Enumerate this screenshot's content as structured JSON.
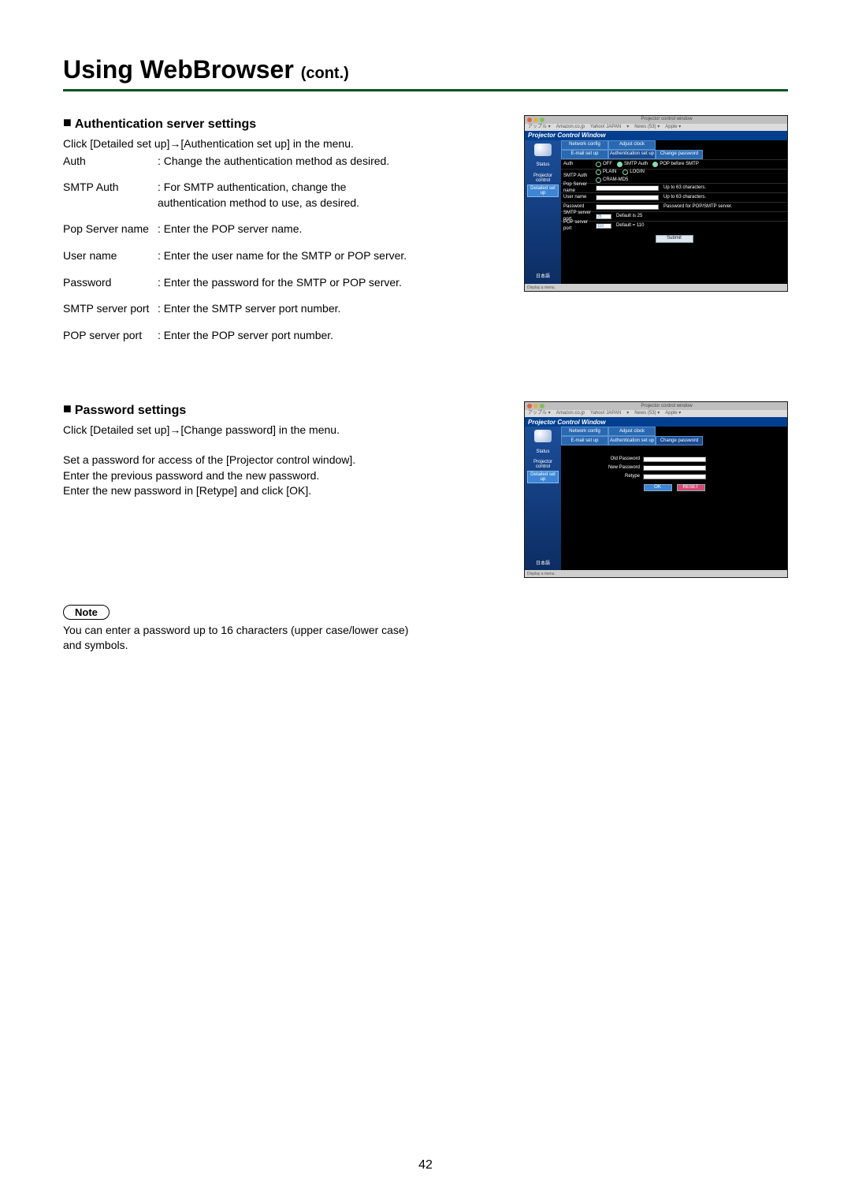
{
  "page_title_main": "Using WebBrowser ",
  "page_title_cont": "(cont.)",
  "page_number": "42",
  "section_auth": {
    "heading": "Authentication server settings",
    "intro": "Click [Detailed set up]→[Authentication set up] in the menu.",
    "items": [
      {
        "label": "Auth",
        "value": "Change the authentication method as desired."
      },
      {
        "label": "SMTP Auth",
        "value": "For SMTP authentication, change the authentication method to use, as desired."
      },
      {
        "label": "Pop Server name",
        "value": "Enter the POP server name."
      },
      {
        "label": "User name",
        "value": "Enter the user name for the SMTP or POP server."
      },
      {
        "label": "Password",
        "value": "Enter the password for the SMTP or POP server."
      },
      {
        "label": "SMTP server port",
        "value": "Enter the SMTP server port number."
      },
      {
        "label": "POP server port",
        "value": "Enter the POP server port number."
      }
    ]
  },
  "section_pw": {
    "heading": "Password settings",
    "intro": "Click [Detailed set up]→[Change password] in the menu.",
    "para1": "Set a password for access of the [Projector control window].",
    "para2": "Enter the previous password and the new password.",
    "para3": "Enter the new password in [Retype] and click [OK].",
    "note_label": "Note",
    "note_body": "You can enter a password up to 16 characters (upper case/lower case) and symbols."
  },
  "win_common": {
    "title": "Projector control window",
    "tabbar": [
      "アップル ▾",
      "Amazon.co.jp",
      "Yahoo! JAPAN",
      "▾",
      "News (53) ▾",
      "Apple ▾"
    ],
    "header": "Projector Control Window",
    "status": "Display a menu.",
    "side": {
      "status": "Status",
      "projector": "Projector control",
      "detailed": "Detailed set up",
      "lang": "日本語"
    },
    "topbtns": {
      "network": "Network config",
      "adjust": "Adjust clock",
      "email": "E-mail set up",
      "auth": "Authentication set up",
      "changepw": "Change password"
    },
    "auth_rows": {
      "auth_label": "Auth",
      "auth_opts": [
        "OFF",
        "SMTP Auth",
        "POP before SMTP"
      ],
      "smtp_label": "SMTP Auth",
      "smtp_opts": [
        "PLAIN",
        "LOGIN",
        "CRAM-MD5"
      ],
      "pop_label": "Pop Server name",
      "pop_note": "Up to 63 characters.",
      "user_label": "User name",
      "user_note": "Up to 63 characters.",
      "pw_label": "Password",
      "pw_note": "Password for POP/SMTP server.",
      "smtpport_label": "SMTP server port",
      "smtpport_val": "25",
      "smtpport_note": "Default is 25",
      "popport_label": "POP server port",
      "popport_val": "110",
      "popport_note": "Default = 110",
      "submit": "Submit"
    },
    "pw_rows": {
      "old": "Old Password",
      "new": "New Password",
      "retype": "Retype",
      "ok": "OK",
      "reset": "RESET"
    }
  }
}
